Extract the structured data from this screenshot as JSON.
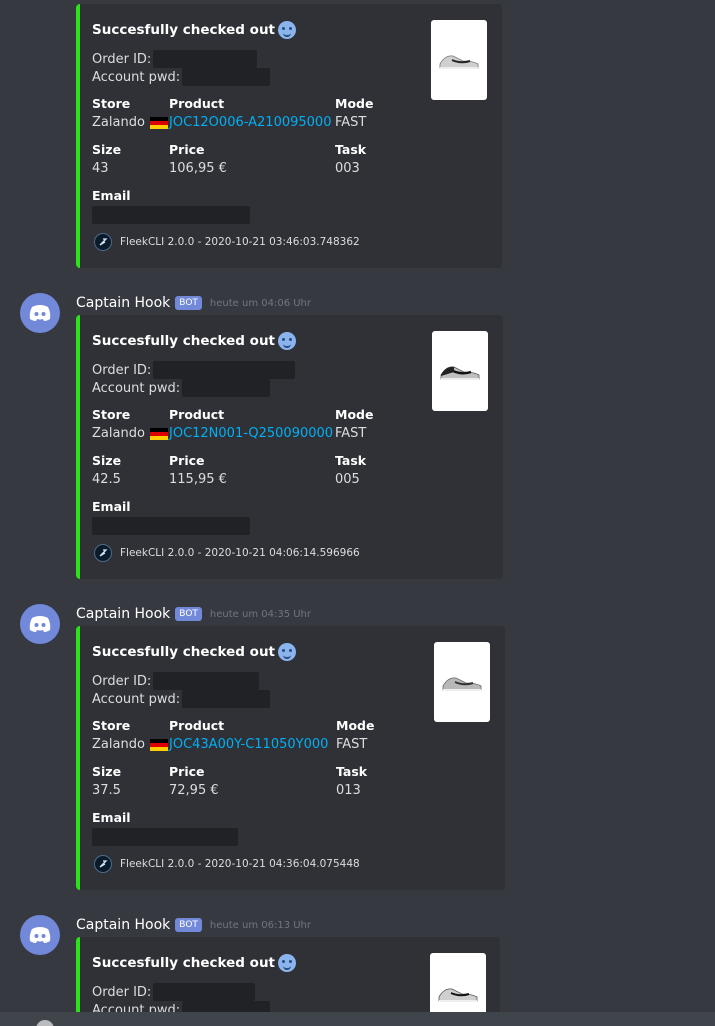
{
  "messages": [
    {
      "username": "",
      "bot_tag": "",
      "timestamp": "",
      "embed": {
        "title": "Succesfully checked out",
        "order_label": "Order ID:",
        "account_label": "Account pwd:",
        "store_label": "Store",
        "store_value": "Zalando",
        "product_label": "Product",
        "product_value": "JOC12O006-A210095000",
        "mode_label": "Mode",
        "mode_value": "FAST",
        "size_label": "Size",
        "size_value": "43",
        "price_label": "Price",
        "price_value": "106,95 €",
        "task_label": "Task",
        "task_value": "003",
        "email_label": "Email",
        "footer": "FleekCLI 2.0.0 - 2020-10-21 03:46:03.748362"
      }
    },
    {
      "username": "Captain Hook",
      "bot_tag": "BOT",
      "timestamp": "heute um 04:06 Uhr",
      "embed": {
        "title": "Succesfully checked out",
        "order_label": "Order ID:",
        "account_label": "Account pwd:",
        "store_label": "Store",
        "store_value": "Zalando",
        "product_label": "Product",
        "product_value": "JOC12N001-Q250090000",
        "mode_label": "Mode",
        "mode_value": "FAST",
        "size_label": "Size",
        "size_value": "42.5",
        "price_label": "Price",
        "price_value": "115,95 €",
        "task_label": "Task",
        "task_value": "005",
        "email_label": "Email",
        "footer": "FleekCLI 2.0.0 - 2020-10-21 04:06:14.596966"
      }
    },
    {
      "username": "Captain Hook",
      "bot_tag": "BOT",
      "timestamp": "heute um 04:35 Uhr",
      "embed": {
        "title": "Succesfully checked out",
        "order_label": "Order ID:",
        "account_label": "Account pwd:",
        "store_label": "Store",
        "store_value": "Zalando",
        "product_label": "Product",
        "product_value": "JOC43A00Y-C11050Y000",
        "mode_label": "Mode",
        "mode_value": "FAST",
        "size_label": "Size",
        "size_value": "37.5",
        "price_label": "Price",
        "price_value": "72,95 €",
        "task_label": "Task",
        "task_value": "013",
        "email_label": "Email",
        "footer": "FleekCLI 2.0.0 - 2020-10-21 04:36:04.075448"
      }
    },
    {
      "username": "Captain Hook",
      "bot_tag": "BOT",
      "timestamp": "heute um 06:13 Uhr",
      "embed": {
        "title": "Succesfully checked out",
        "order_label": "Order ID:",
        "account_label": "Account pwd:"
      }
    }
  ],
  "colors": {
    "background": "#36393f",
    "embed_background": "#2f3136",
    "embed_accent": "#2ce21a",
    "link": "#00b0f4",
    "bot_tag": "#7289da"
  },
  "icons": {
    "avatar": "discord-logo-icon",
    "thumbnail": "sneaker-thumbnail",
    "footer": "fleek-logo-icon",
    "emoji": "smiling-face-emoji",
    "flag": "germany-flag-icon"
  }
}
